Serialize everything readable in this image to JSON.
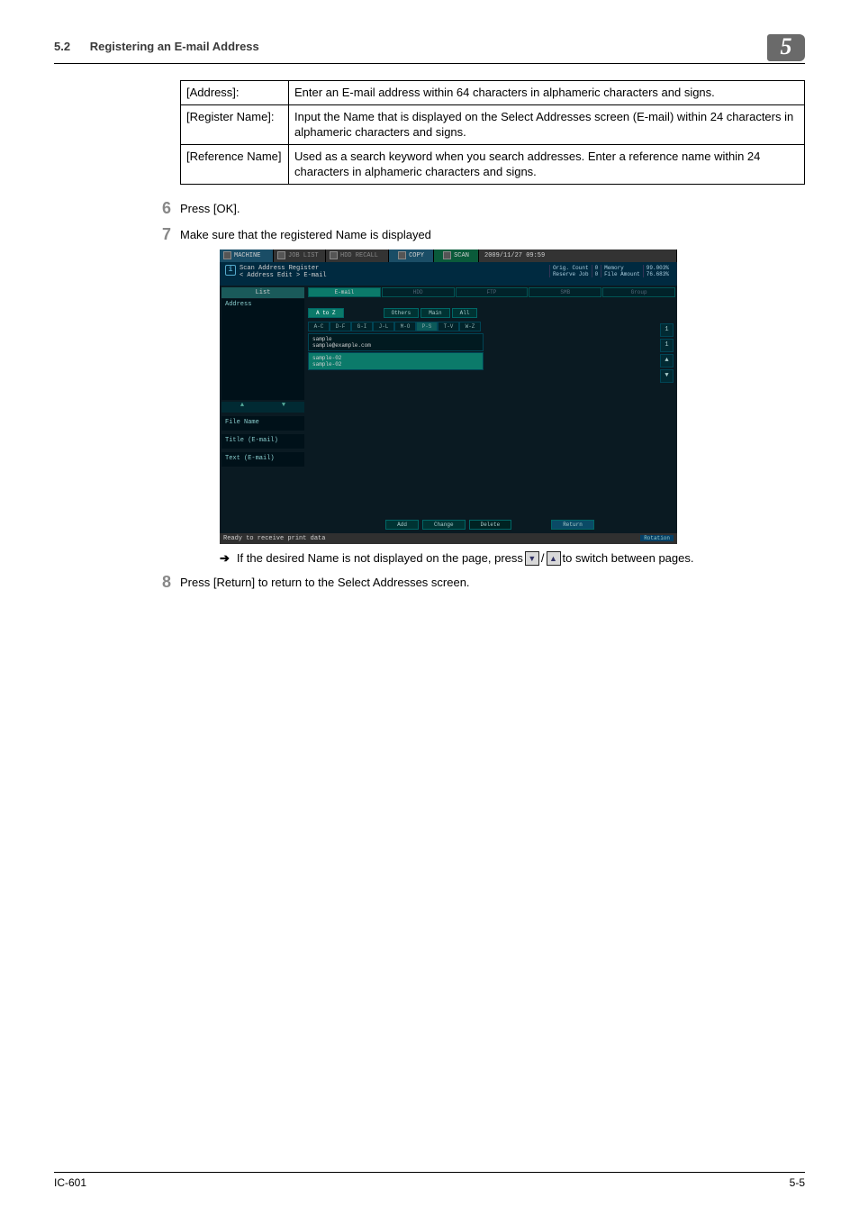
{
  "header": {
    "sec_num": "5.2",
    "sec_title": "Registering an E-mail Address",
    "chapter": "5"
  },
  "table": {
    "rows": [
      {
        "label": "[Address]:",
        "desc": "Enter an E-mail address within 64 characters in alphameric characters and signs."
      },
      {
        "label": "[Register Name]:",
        "desc": "Input the Name that is displayed on the Select Addresses screen (E-mail) within 24 characters in alphameric characters and signs."
      },
      {
        "label": "[Reference Name]",
        "desc": "Used as a search keyword when you search addresses.  Enter a reference name within 24 characters in alphameric characters and signs."
      }
    ]
  },
  "steps": {
    "s6": {
      "num": "6",
      "text": "Press [OK]."
    },
    "s7": {
      "num": "7",
      "text": "Make sure that the registered Name is displayed"
    },
    "s8": {
      "num": "8",
      "text": "Press [Return] to return to the Select Addresses screen."
    }
  },
  "note": {
    "pre": "If the desired Name is not displayed on the page, press ",
    "mid": " / ",
    "post": " to switch between pages."
  },
  "footer": {
    "left": "IC-601",
    "right": "5-5"
  },
  "screenshot": {
    "top_tabs": {
      "machine": "MACHINE",
      "joblist": "JOB LIST",
      "hddrecall": "HDD RECALL",
      "copy": "COPY",
      "scan": "SCAN",
      "time": "2009/11/27 09:59"
    },
    "breadcrumb_line1": "Scan Address Register",
    "breadcrumb_line2": "< Address Edit > E-mail",
    "status_right": {
      "r1c1": "Orig. Count",
      "r1c2": "0",
      "r1c3": "Memory",
      "r1c4": "99.003%",
      "r2c1": "Reserve Job",
      "r2c2": "0",
      "r2c3": "File Amount",
      "r2c4": "76.683%"
    },
    "side": {
      "list": "List",
      "address": "Address",
      "file_name": "File Name",
      "title": "Title (E-mail)",
      "text": "Text (E-mail)"
    },
    "category_tabs": [
      "E-mail",
      "HDD",
      "FTP",
      "SMB",
      "Group"
    ],
    "filter_row": [
      "A to Z",
      "Others",
      "Main",
      "All"
    ],
    "alpha_row": [
      "A-C",
      "D-F",
      "G-I",
      "J-L",
      "M-O",
      "P-S",
      "T-V",
      "W-Z"
    ],
    "entries": [
      {
        "name": "sample",
        "detail": "sample@example.com",
        "selected": false
      },
      {
        "name": "sample-02",
        "detail": "sample-02",
        "selected": true
      }
    ],
    "page_indicator": {
      "cur": "1",
      "total": "1"
    },
    "bottom_buttons": {
      "add": "Add",
      "change": "Change",
      "delete": "Delete",
      "return": "Return"
    },
    "status_bar": {
      "ready": "Ready to receive print data",
      "rotation": "Rotation"
    }
  }
}
